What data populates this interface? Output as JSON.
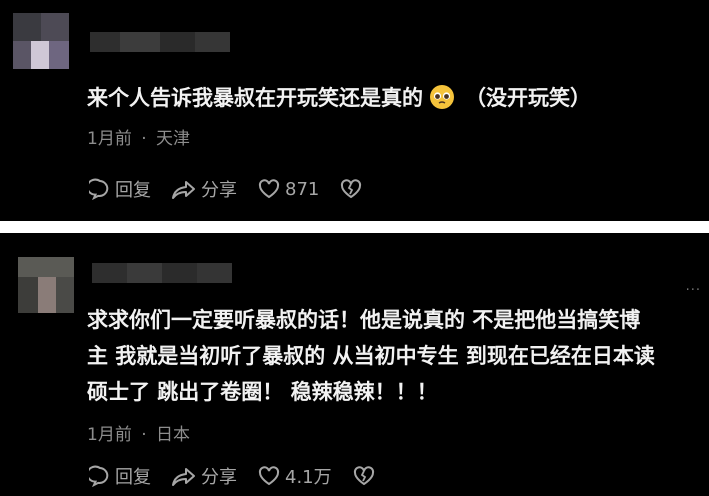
{
  "comments": [
    {
      "text_lines": [
        "来个人告诉我暴叔在开玩笑还是真的",
        "（没开玩笑）"
      ],
      "emoji_icon": "pleading-face-emoji",
      "meta": {
        "time": "1月前",
        "separator": "·",
        "location": "天津"
      },
      "actions": {
        "reply_label": "回复",
        "share_label": "分享",
        "like_count": "871"
      }
    },
    {
      "text_lines": [
        "求求你们一定要听暴叔的话！他是说真的 不是把他当搞笑博",
        "主 我就是当初听了暴叔的 从当初中专生 到现在已经在日本读",
        "硕士了 跳出了卷圈！ 稳辣稳辣！！！"
      ],
      "meta": {
        "time": "1月前",
        "separator": "·",
        "location": "日本"
      },
      "actions": {
        "reply_label": "回复",
        "share_label": "分享",
        "like_count": "4.1万"
      },
      "more_icon": "more-dots-icon"
    }
  ],
  "colors": {
    "background": "#000000",
    "divider": "#ffffff",
    "text": "#f2f2f2",
    "meta": "#8d8d8d",
    "action": "#a6a6a6"
  }
}
